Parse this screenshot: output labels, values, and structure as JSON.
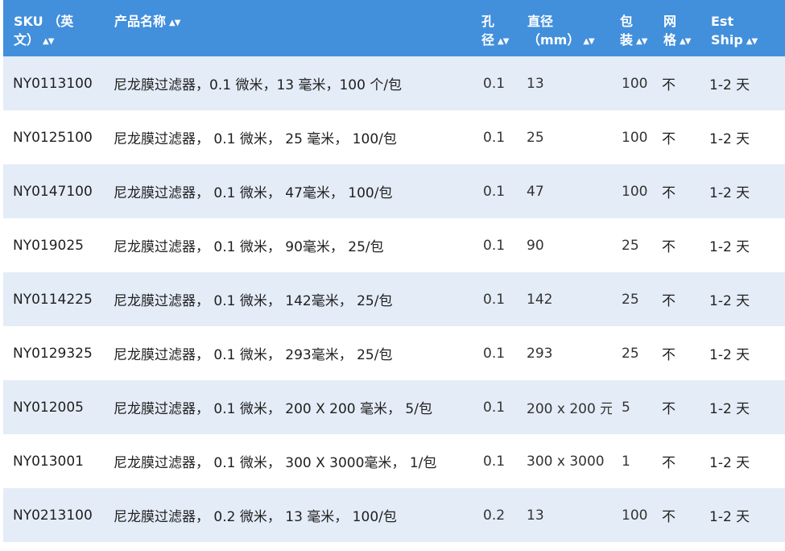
{
  "table": {
    "headers": [
      {
        "lines": [
          "SKU （英",
          "文）"
        ]
      },
      {
        "lines": [
          "产品名称"
        ]
      },
      {
        "lines": [
          "孔",
          "径"
        ]
      },
      {
        "lines": [
          "直径",
          "（mm）"
        ]
      },
      {
        "lines": [
          "包",
          "装"
        ]
      },
      {
        "lines": [
          "网",
          "格"
        ]
      },
      {
        "lines": [
          "Est",
          "Ship"
        ]
      }
    ],
    "rows": [
      {
        "sku": "NY0113100",
        "name": "尼龙膜过滤器，0.1 微米，13 毫米，100 个/包",
        "pore": "0.1",
        "diameter": "13",
        "pack": "100",
        "grid": "不",
        "ship": "1-2 天"
      },
      {
        "sku": "NY0125100",
        "name": "尼龙膜过滤器， 0.1 微米， 25 毫米， 100/包",
        "pore": "0.1",
        "diameter": "25",
        "pack": "100",
        "grid": "不",
        "ship": "1-2 天"
      },
      {
        "sku": "NY0147100",
        "name": "尼龙膜过滤器， 0.1 微米， 47毫米， 100/包",
        "pore": "0.1",
        "diameter": "47",
        "pack": "100",
        "grid": "不",
        "ship": "1-2 天"
      },
      {
        "sku": "NY019025",
        "name": "尼龙膜过滤器， 0.1 微米， 90毫米， 25/包",
        "pore": "0.1",
        "diameter": "90",
        "pack": "25",
        "grid": "不",
        "ship": "1-2 天"
      },
      {
        "sku": "NY0114225",
        "name": "尼龙膜过滤器， 0.1 微米， 142毫米， 25/包",
        "pore": "0.1",
        "diameter": "142",
        "pack": "25",
        "grid": "不",
        "ship": "1-2 天"
      },
      {
        "sku": "NY0129325",
        "name": "尼龙膜过滤器， 0.1 微米， 293毫米， 25/包",
        "pore": "0.1",
        "diameter": "293",
        "pack": "25",
        "grid": "不",
        "ship": "1-2 天"
      },
      {
        "sku": "NY012005",
        "name": "尼龙膜过滤器， 0.1 微米， 200 X 200 毫米， 5/包",
        "pore": "0.1",
        "diameter": "200 x 200 元",
        "pack": "5",
        "grid": "不",
        "ship": "1-2 天"
      },
      {
        "sku": "NY013001",
        "name": "尼龙膜过滤器， 0.1 微米， 300 X 3000毫米， 1/包",
        "pore": "0.1",
        "diameter": "300 x 3000",
        "pack": "1",
        "grid": "不",
        "ship": "1-2 天"
      },
      {
        "sku": "NY0213100",
        "name": "尼龙膜过滤器， 0.2 微米， 13 毫米， 100/包",
        "pore": "0.2",
        "diameter": "13",
        "pack": "100",
        "grid": "不",
        "ship": "1-2 天"
      }
    ]
  }
}
